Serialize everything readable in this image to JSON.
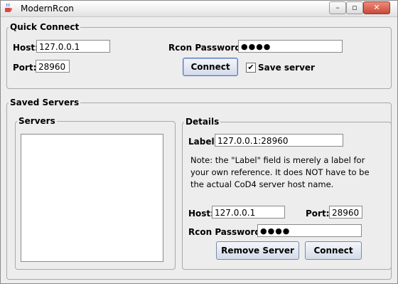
{
  "window": {
    "title": "ModernRcon"
  },
  "quick_connect": {
    "legend": "Quick Connect",
    "host_label": "Host:",
    "host_value": "127.0.0.1",
    "port_label": "Port:",
    "port_value": "28960",
    "password_label": "Rcon Password:",
    "password_value": "●●●●",
    "connect_label": "Connect",
    "save_server_label": "Save server",
    "save_server_checked": true
  },
  "saved_servers": {
    "legend": "Saved Servers",
    "servers_legend": "Servers",
    "servers": [],
    "details": {
      "legend": "Details",
      "label_label": "Label:",
      "label_value": "127.0.0.1:28960",
      "note": "Note: the \"Label\" field is merely a label for your own reference. It does NOT have to be the actual CoD4 server host name.",
      "host_label": "Host:",
      "host_value": "127.0.0.1",
      "port_label": "Port:",
      "port_value": "28960",
      "password_label": "Rcon Password:",
      "password_value": "●●●●",
      "remove_label": "Remove Server",
      "connect_label": "Connect"
    }
  }
}
